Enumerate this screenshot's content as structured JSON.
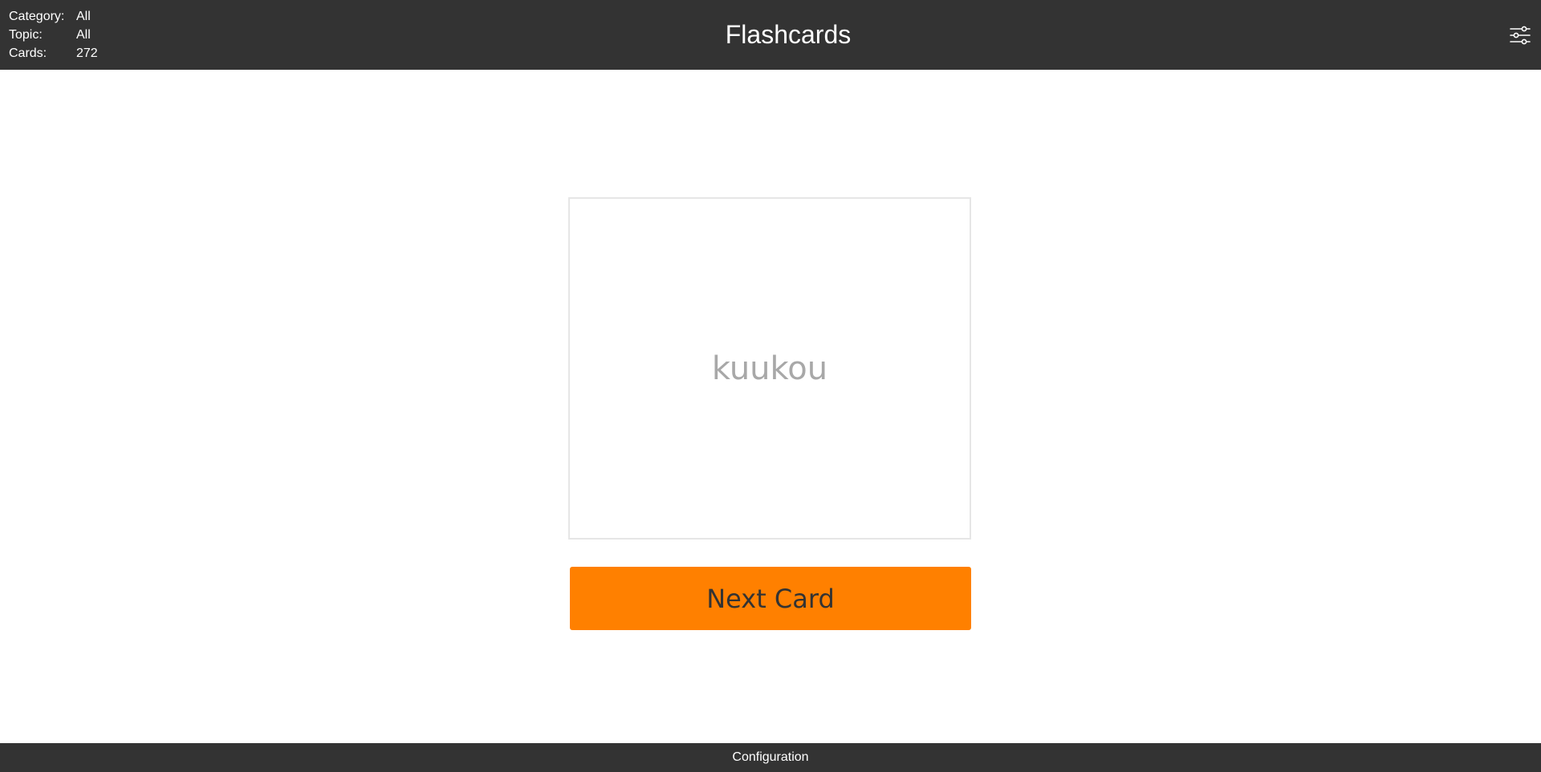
{
  "header": {
    "title": "Flashcards",
    "info": [
      {
        "label": "Category:",
        "value": "All"
      },
      {
        "label": "Topic:",
        "value": "All"
      },
      {
        "label": "Cards:",
        "value": "272"
      }
    ],
    "settings_icon": "sliders-icon"
  },
  "card": {
    "text": "kuukou"
  },
  "next_button": {
    "label": "Next Card"
  },
  "footer": {
    "label": "Configuration"
  },
  "colors": {
    "header_bg": "#333333",
    "accent": "#ff8000",
    "card_text": "#a8a8a8"
  }
}
